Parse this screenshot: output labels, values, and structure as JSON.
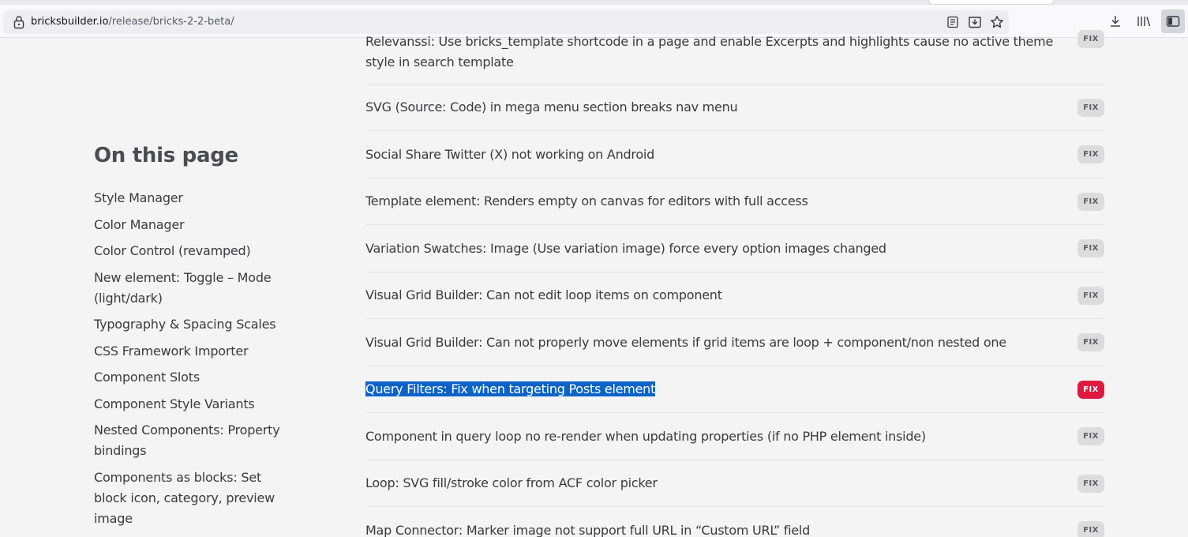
{
  "browser": {
    "url_domain": "bricksbuilder.io",
    "url_path": "/release/bricks-2-2-beta/",
    "icons": [
      "lock-icon",
      "reader-view-icon",
      "save-to-pocket-icon",
      "bookmark-star-icon",
      "downloads-icon",
      "library-icon",
      "sidebar-icon"
    ]
  },
  "toc": {
    "title": "On this page",
    "items": [
      "Style Manager",
      "Color Manager",
      "Color Control (revamped)",
      "New element: Toggle – Mode (light/dark)",
      "Typography & Spacing Scales",
      "CSS Framework Importer",
      "Component Slots",
      "Component Style Variants",
      "Nested Components: Property bindings",
      "Components as blocks: Set block icon, category, preview image"
    ]
  },
  "changes": [
    {
      "text": "Relevanssi: Use bricks_template shortcode in a page and enable Excerpts and highlights cause no active theme style in search template",
      "badge": "FIX"
    },
    {
      "text": "SVG (Source: Code) in mega menu section breaks nav menu",
      "badge": "FIX"
    },
    {
      "text": "Social Share Twitter (X) not working on Android",
      "badge": "FIX"
    },
    {
      "text": "Template element: Renders empty on canvas for editors with full access",
      "badge": "FIX"
    },
    {
      "text": "Variation Swatches: Image (Use variation image) force every option images changed",
      "badge": "FIX"
    },
    {
      "text": "Visual Grid Builder: Can not edit loop items on component",
      "badge": "FIX"
    },
    {
      "text": "Visual Grid Builder: Can not properly move elements if grid items are loop + component/non nested one",
      "badge": "FIX"
    },
    {
      "text": "Query Filters: Fix when targeting Posts element",
      "badge": "FIX",
      "selected": true
    },
    {
      "text": "Component in query loop no re-render when updating properties (if no PHP element inside)",
      "badge": "FIX"
    },
    {
      "text": "Loop: SVG fill/stroke color from ACF color picker",
      "badge": "FIX"
    },
    {
      "text": "Map Connector: Marker image not support full URL in “Custom URL” field",
      "badge": "FIX"
    }
  ],
  "colors": {
    "badge_default": "#dcdcdc",
    "badge_highlight": "#e0193f",
    "selection": "#0b63c7",
    "page_bg": "#f4f4f4"
  }
}
